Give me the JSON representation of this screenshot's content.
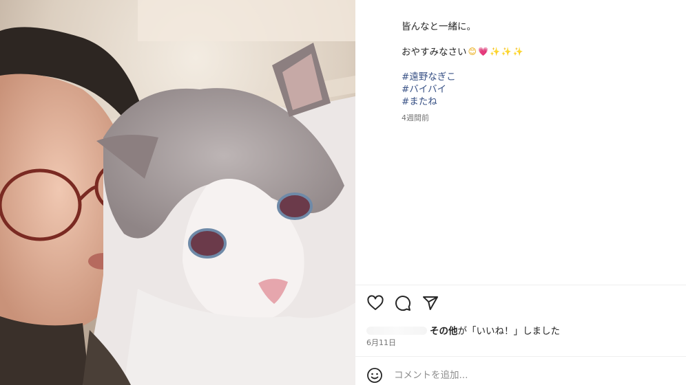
{
  "photo": {
    "alt_description": ""
  },
  "caption": {
    "line1": "皆んなと一緒に。",
    "line2": "おやすみなさい",
    "emojis": {
      "smile": "😊",
      "heart": "💗",
      "spark": "✨"
    },
    "hashtags": [
      "#遠野なぎこ",
      "#バイバイ",
      "#またね"
    ]
  },
  "time_ago": "4週間前",
  "actions": {
    "icons": [
      "heart-icon",
      "comment-icon",
      "share-icon"
    ]
  },
  "likes": {
    "name": "その他",
    "text": "が「いいね！」しました"
  },
  "post_date": "6月11日",
  "comment": {
    "placeholder": "コメントを追加..."
  },
  "colors": {
    "hashtag": "#385185",
    "muted": "#737373",
    "divider": "#efefef"
  }
}
